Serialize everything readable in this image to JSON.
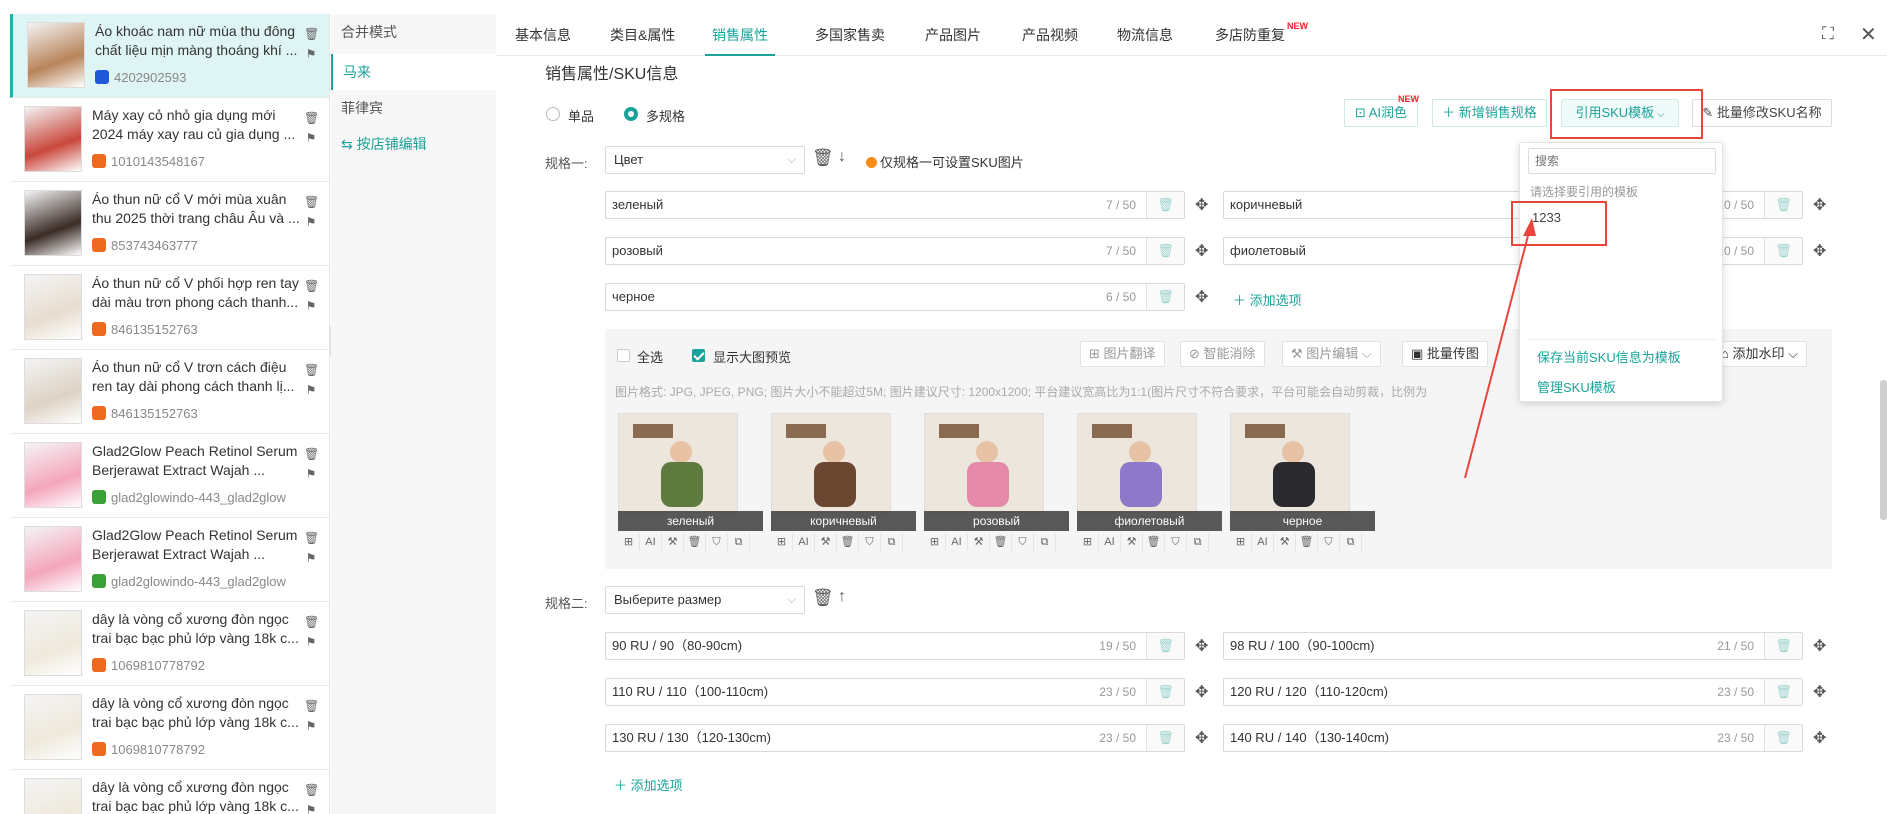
{
  "products": [
    {
      "title": "Áo khoác nam nữ mùa thu đông chất liệu mịn màng thoáng khí ...",
      "id": "4202902593",
      "shop_color": "#1e58d8",
      "thumb_color": "#b8845a"
    },
    {
      "title": "Máy xay cỏ nhỏ gia dụng mới 2024 máy xay rau củ gia dụng ...",
      "id": "1010143548167",
      "shop_color": "#ee6a1e",
      "thumb_color": "#c9473b"
    },
    {
      "title": "Áo thun nữ cổ V mới mùa xuân thu 2025 thời trang châu Âu và ...",
      "id": "853743463777",
      "shop_color": "#ee6a1e",
      "thumb_color": "#3a2b25"
    },
    {
      "title": "Áo thun nữ cổ V phối hợp ren tay dài màu trơn phong cách thanh...",
      "id": "846135152763",
      "shop_color": "#ee6a1e",
      "thumb_color": "#e8ddd0"
    },
    {
      "title": "Áo thun nữ cổ V trơn cách điệu ren tay dài phong cách thanh lị...",
      "id": "846135152763",
      "shop_color": "#ee6a1e",
      "thumb_color": "#ddd2c4"
    },
    {
      "title": "Glad2Glow Peach Retinol Serum Berjerawat Extract Wajah ...",
      "id": "glad2glowindo-443_glad2glow",
      "shop_color": "#3aa038",
      "thumb_color": "#f4a6bd"
    },
    {
      "title": "Glad2Glow Peach Retinol Serum Berjerawat Extract Wajah ...",
      "id": "glad2glowindo-443_glad2glow",
      "shop_color": "#3aa038",
      "thumb_color": "#f4a6bd"
    },
    {
      "title": "dây là vòng cổ xương đòn ngọc trai bạc bạc phủ lớp vàng 18k c...",
      "id": "1069810778792",
      "shop_color": "#ee6a1e",
      "thumb_color": "#efe9dc"
    },
    {
      "title": "dây là vòng cổ xương đòn ngọc trai bạc bạc phủ lớp vàng 18k c...",
      "id": "1069810778792",
      "shop_color": "#ee6a1e",
      "thumb_color": "#efe9dc"
    },
    {
      "title": "dây là vòng cổ xương đòn ngọc trai bạc bạc phủ lớp vàng 18k c...",
      "id": "",
      "shop_color": "#ee6a1e",
      "thumb_color": "#efe9dc"
    }
  ],
  "subnav": {
    "merge": "合并模式",
    "malaysia": "马来",
    "philippines": "菲律宾",
    "by_shop": "按店铺编辑"
  },
  "tabs": [
    "基本信息",
    "类目&属性",
    "销售属性",
    "多国家售卖",
    "产品图片",
    "产品视频",
    "物流信息",
    "多店防重复"
  ],
  "tab_new_badge": "NEW",
  "section_title": "销售属性/SKU信息",
  "mode": {
    "single": "单品",
    "multi": "多规格"
  },
  "buttons": {
    "ai_color": "AI润色",
    "ai_badge": "NEW",
    "add_attr": "新增销售规格",
    "ref_template": "引用SKU模板",
    "batch_rename": "批量修改SKU名称"
  },
  "spec1": {
    "label": "规格一:",
    "select": "Цвет",
    "hint": "仅规格一可设置SKU图片",
    "options": [
      {
        "value": "зеленый",
        "count": "7 / 50"
      },
      {
        "value": "коричневый",
        "count": "10 / 50"
      },
      {
        "value": "розовый",
        "count": "7 / 50"
      },
      {
        "value": "фиолетовый",
        "count": "10 / 50"
      },
      {
        "value": "черное",
        "count": "6 / 50"
      }
    ],
    "add_option": "添加选项"
  },
  "image_panel": {
    "select_all": "全选",
    "show_preview": "显示大图预览",
    "tools": [
      "图片翻译",
      "智能消除",
      "图片编辑",
      "批量传图",
      "添加水印"
    ],
    "note": "图片格式: JPG, JPEG, PNG; 图片大小不能超过5M; 图片建议尺寸: 1200x1200; 平台建议宽高比为1:1(图片尺寸不符合要求，平台可能会自动剪裁，比例为",
    "images": [
      {
        "caption": "зеленый",
        "jacket": "#5e7a3e"
      },
      {
        "caption": "коричневый",
        "jacket": "#6b4630"
      },
      {
        "caption": "розовый",
        "jacket": "#e58aa8"
      },
      {
        "caption": "фиолетовый",
        "jacket": "#8d78c9"
      },
      {
        "caption": "черное",
        "jacket": "#2a2a2e"
      }
    ],
    "icon_ai": "AI"
  },
  "spec2": {
    "label": "规格二:",
    "select": "Выберите размер",
    "options": [
      {
        "value": "90 RU / 90（80-90cm)",
        "count": "19 / 50"
      },
      {
        "value": "98 RU / 100（90-100cm)",
        "count": "21 / 50"
      },
      {
        "value": "110 RU / 110（100-110cm)",
        "count": "23 / 50"
      },
      {
        "value": "120 RU / 120（110-120cm)",
        "count": "23 / 50"
      },
      {
        "value": "130 RU / 130（120-130cm)",
        "count": "23 / 50"
      },
      {
        "value": "140 RU / 140（130-140cm)",
        "count": "23 / 50"
      }
    ],
    "add_option": "添加选项"
  },
  "dropdown": {
    "search_placeholder": "搜索",
    "hint": "请选择要引用的模板",
    "template": "1233",
    "save": "保存当前SKU信息为模板",
    "manage": "管理SKU模板"
  },
  "colors": {
    "accent": "#1aa39a",
    "annotation_red": "#e8453c"
  }
}
